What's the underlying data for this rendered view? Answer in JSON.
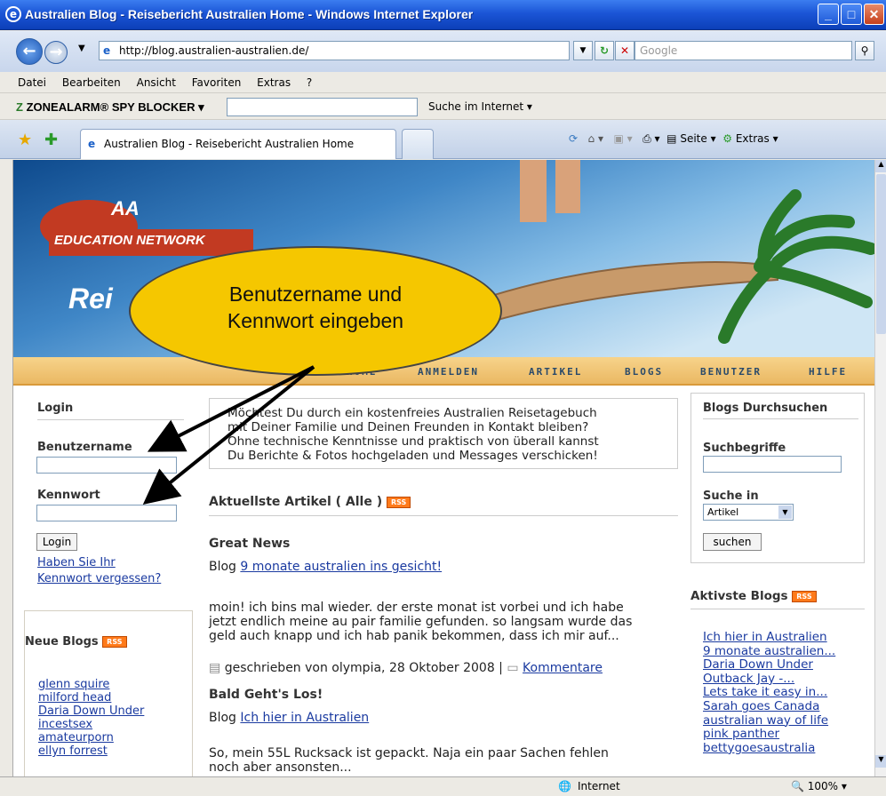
{
  "window": {
    "title": "Australien Blog - Reisebericht Australien Home - Windows Internet Explorer"
  },
  "address": {
    "url": "http://blog.australien-australien.de/",
    "search_placeholder": "Google"
  },
  "menu": [
    "Datei",
    "Bearbeiten",
    "Ansicht",
    "Favoriten",
    "Extras",
    "?"
  ],
  "zonealarm": {
    "logo": "ZONEALARM® SPY BLOCKER",
    "search_label": "Suche im Internet"
  },
  "tabs": {
    "active": "Australien Blog - Reisebericht Australien Home",
    "tools": {
      "page": "Seite",
      "extras": "Extras"
    }
  },
  "banner": {
    "logo_aa": "AA",
    "logo_text": "EDUCATION NETWORK",
    "title_partial": "Rei"
  },
  "nav": [
    "HOME",
    "ANMELDEN",
    "ARTIKEL",
    "BLOGS",
    "BENUTZER",
    "HILFE"
  ],
  "callout": {
    "line1": "Benutzername und",
    "line2": "Kennwort eingeben"
  },
  "login": {
    "heading": "Login",
    "username_label": "Benutzername",
    "password_label": "Kennwort",
    "button": "Login",
    "forgot_line1": "Haben Sie Ihr",
    "forgot_line2": "Kennwort vergessen?"
  },
  "neue_blogs": {
    "heading": "Neue Blogs",
    "rss": "RSS",
    "items": [
      "glenn squire",
      "milford head",
      "Daria Down Under",
      "incestsex",
      "amateurporn",
      "ellyn forrest"
    ]
  },
  "intro": {
    "lines": [
      "Möchtest Du durch ein kostenfreies Australien Reisetagebuch",
      "mit Deiner Familie und Deinen Freunden in Kontakt bleiben?",
      "Ohne technische Kenntnisse und praktisch von überall kannst",
      "Du Berichte & Fotos hochgeladen und Messages verschicken!"
    ]
  },
  "articles": {
    "heading": "Aktuellste Artikel ( Alle )",
    "rss": "RSS",
    "a1": {
      "title": "Great News",
      "blog_prefix": "Blog",
      "blog_link": "9 monate australien ins gesicht!",
      "body": [
        "moin! ich bins mal wieder. der erste monat ist vorbei und ich habe",
        "jetzt endlich meine au pair familie gefunden. so langsam wurde das",
        "geld auch knapp und ich hab panik bekommen, dass ich mir auf..."
      ],
      "meta": "geschrieben von olympia, 28 Oktober 2008 |",
      "comments": "Kommentare"
    },
    "a2": {
      "title": "Bald Geht's Los!",
      "blog_prefix": "Blog",
      "blog_link": "Ich hier in Australien",
      "body": [
        "So, mein 55L Rucksack ist gepackt. Naja ein paar Sachen fehlen",
        "noch aber ansonsten..."
      ]
    }
  },
  "search": {
    "heading": "Blogs Durchsuchen",
    "terms_label": "Suchbegriffe",
    "in_label": "Suche in",
    "select_value": "Artikel",
    "button": "suchen"
  },
  "active_blogs": {
    "heading": "Aktivste Blogs",
    "rss": "RSS",
    "items": [
      "Ich hier in Australien",
      "9 monate australien...",
      "Daria Down Under",
      "Outback Jay -...",
      "Lets take it easy in...",
      "Sarah goes Canada",
      "australian way of life",
      "pink panther",
      "bettygoesaustralia"
    ]
  },
  "status": {
    "zone": "Internet",
    "zoom": "100%"
  }
}
